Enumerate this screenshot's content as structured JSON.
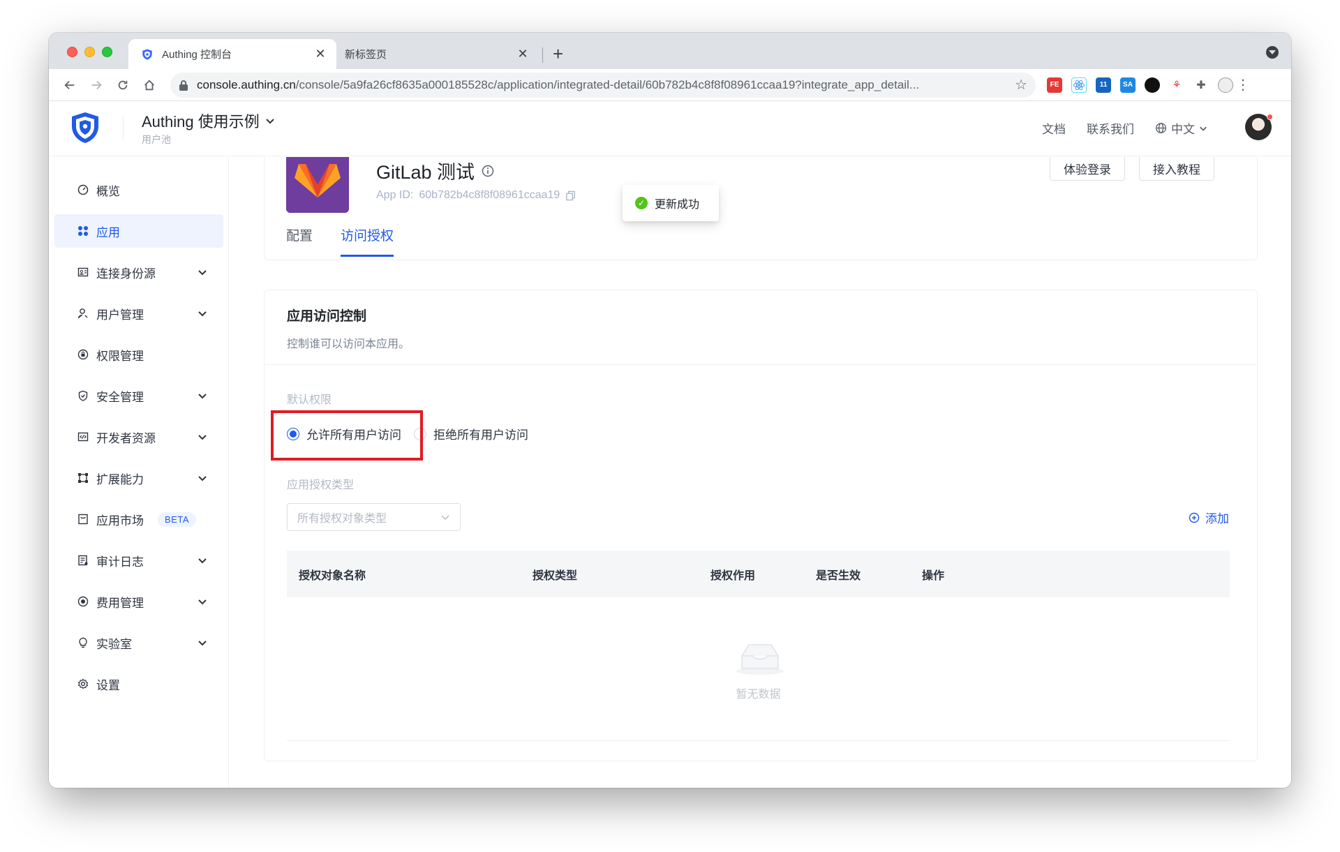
{
  "browser": {
    "tabs": [
      {
        "title": "Authing 控制台",
        "close": "✕"
      },
      {
        "title": "新标签页",
        "close": "✕"
      }
    ],
    "new_tab": "+",
    "url_host": "console.authing.cn",
    "url_path": "/console/5a9fa26cf8635a000185528c/application/integrated-detail/60b782b4c8f8f08961ccaa19?integrate_app_detail..."
  },
  "header": {
    "pool_name": "Authing 使用示例",
    "pool_subtitle": "用户池",
    "links": [
      "文档",
      "联系我们"
    ],
    "language": "中文"
  },
  "toast": {
    "message": "更新成功"
  },
  "sidebar": {
    "items": [
      {
        "label": "概览",
        "icon": "dashboard-icon",
        "expandable": false
      },
      {
        "label": "应用",
        "icon": "apps-icon",
        "expandable": false,
        "active": true
      },
      {
        "label": "连接身份源",
        "icon": "identity-source-icon",
        "expandable": true
      },
      {
        "label": "用户管理",
        "icon": "user-icon",
        "expandable": true
      },
      {
        "label": "权限管理",
        "icon": "permission-icon",
        "expandable": false
      },
      {
        "label": "安全管理",
        "icon": "shield-icon",
        "expandable": true
      },
      {
        "label": "开发者资源",
        "icon": "code-icon",
        "expandable": true
      },
      {
        "label": "扩展能力",
        "icon": "extension-icon",
        "expandable": true
      },
      {
        "label": "应用市场",
        "icon": "market-icon",
        "expandable": false,
        "badge": "BETA"
      },
      {
        "label": "审计日志",
        "icon": "audit-log-icon",
        "expandable": true
      },
      {
        "label": "费用管理",
        "icon": "billing-icon",
        "expandable": true
      },
      {
        "label": "实验室",
        "icon": "bulb-icon",
        "expandable": true
      },
      {
        "label": "设置",
        "icon": "gear-icon",
        "expandable": false
      }
    ]
  },
  "app": {
    "title": "GitLab 测试",
    "app_id_label": "App ID:",
    "app_id": "60b782b4c8f8f08961ccaa19",
    "buttons": {
      "try_login": "体验登录",
      "tutorial": "接入教程"
    },
    "tabs": [
      {
        "label": "配置",
        "active": false
      },
      {
        "label": "访问授权",
        "active": true
      }
    ]
  },
  "access_control": {
    "title": "应用访问控制",
    "description": "控制谁可以访问本应用。",
    "default_permission_label": "默认权限",
    "options": [
      {
        "label": "允许所有用户访问",
        "selected": true
      },
      {
        "label": "拒绝所有用户访问",
        "selected": false
      }
    ],
    "auth_type_label": "应用授权类型",
    "auth_type_placeholder": "所有授权对象类型",
    "add_label": "添加",
    "table": {
      "columns": [
        "授权对象名称",
        "授权类型",
        "授权作用",
        "是否生效",
        "操作"
      ],
      "rows": [],
      "empty_text": "暂无数据"
    }
  },
  "colors": {
    "primary": "#215ae5",
    "success": "#52c41a",
    "highlight": "#e01b24"
  }
}
